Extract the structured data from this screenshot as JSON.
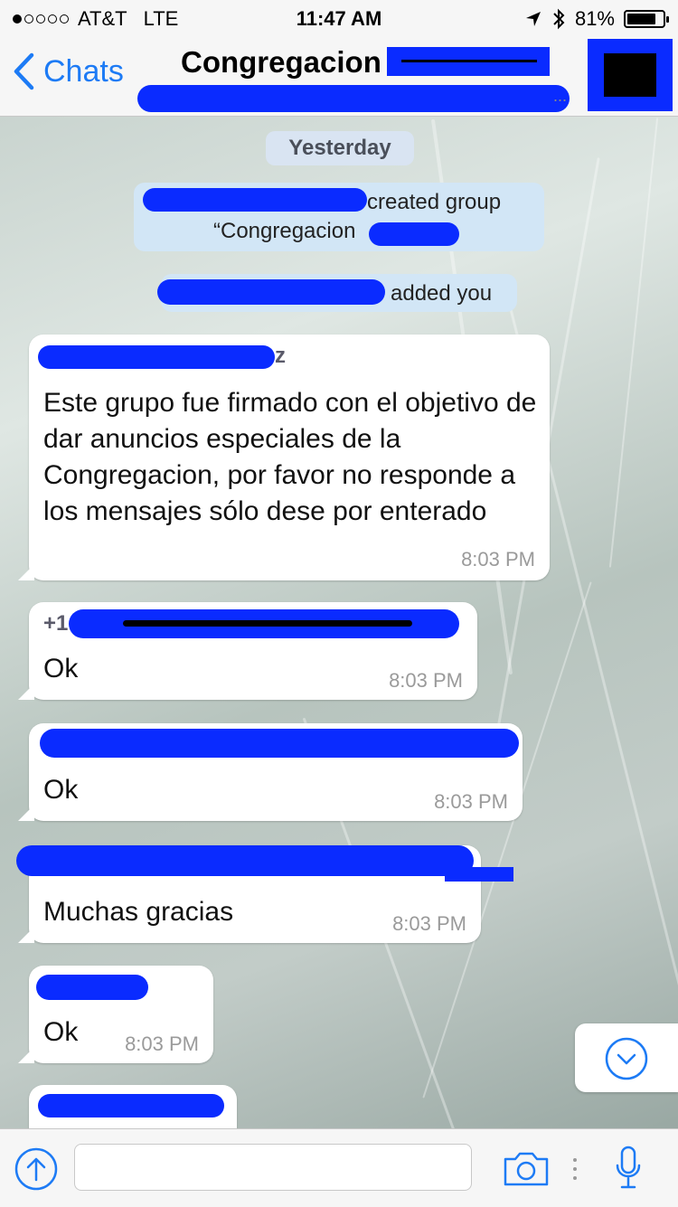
{
  "status_bar": {
    "carrier": "AT&T",
    "network": "LTE",
    "time": "11:47 AM",
    "battery": "81%",
    "battery_level": 0.81
  },
  "nav": {
    "back_label": "Chats",
    "title": "Congregacion"
  },
  "chat": {
    "day_label": "Yesterday",
    "system_messages": [
      {
        "line1": "created group",
        "line2": "“Congregacion"
      },
      {
        "text": "added you"
      }
    ],
    "messages": [
      {
        "sender_visible": "z",
        "text": "Este grupo fue firmado con el objetivo de dar anuncios especiales de la Congregacion, por favor no responde a los mensajes sólo dese por enterado",
        "time": "8:03 PM"
      },
      {
        "sender_visible": "+1",
        "text": "Ok",
        "time": "8:03 PM"
      },
      {
        "sender_visible": "",
        "text": "Ok",
        "time": "8:03 PM"
      },
      {
        "sender_visible": "",
        "text": "Muchas gracias",
        "time": "8:03 PM"
      },
      {
        "sender_visible": "",
        "text": "Ok",
        "time": "8:03 PM"
      },
      {
        "sender_visible": "",
        "text": "",
        "time": ""
      }
    ]
  },
  "colors": {
    "accent": "#1d7bf5",
    "redaction": "#0a2bff",
    "sender_gray": "#5a5a6a",
    "sender_orange": "#e07a3a"
  },
  "icons": {
    "back": "chevron-left-icon",
    "location": "location-arrow-icon",
    "bluetooth": "bluetooth-icon",
    "scroll": "chevron-down-circle-icon",
    "upload": "arrow-up-circle-icon",
    "camera": "camera-icon",
    "mic": "microphone-icon"
  }
}
